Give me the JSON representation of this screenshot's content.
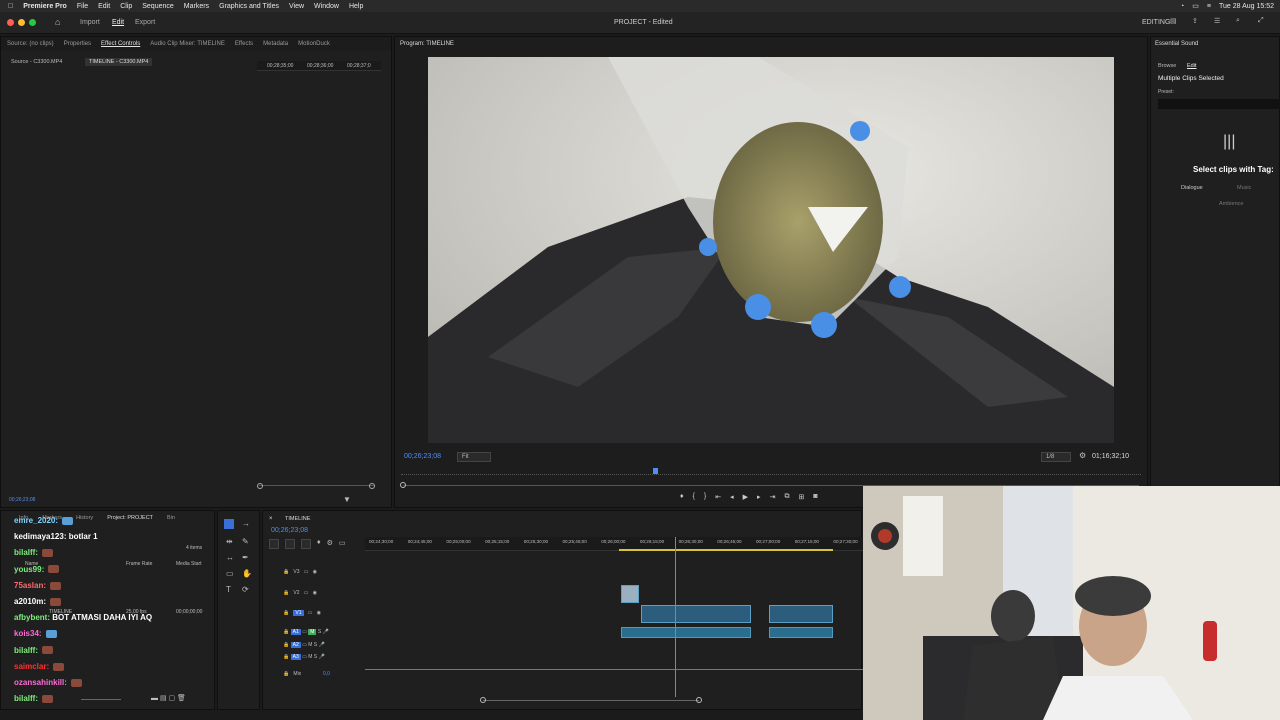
{
  "menubar": {
    "app": "Premiere Pro",
    "items": [
      "File",
      "Edit",
      "Clip",
      "Sequence",
      "Markers",
      "Graphics and Titles",
      "View",
      "Window",
      "Help"
    ],
    "datetime": "Tue 28 Aug 15:52"
  },
  "titlebar": {
    "home_tabs": [
      "Import",
      "Edit",
      "Export"
    ],
    "active_home_tab": "Edit",
    "title": "PROJECT - Edited",
    "workspace": "EDITING"
  },
  "source_panel": {
    "tabs": [
      "Source: (no clips)",
      "Properties",
      "Effect Controls",
      "Audio Clip Mixer: TIMELINE",
      "Effects",
      "Metadata",
      "MotionDuck"
    ],
    "active_tab": "Effect Controls",
    "subtabs": [
      "Source - C3300.MP4",
      "TIMELINE - C3300.MP4"
    ],
    "ruler_times": [
      "00;28;35;00",
      "00;28;36;00",
      "00;28;37;0"
    ],
    "timecode": "00;26;23;08"
  },
  "program_monitor": {
    "title": "Program: TIMELINE",
    "timecode": "00;26;23;08",
    "fit": "Fit",
    "resolution": "1/8",
    "duration": "01;16;32;10"
  },
  "essential_sound": {
    "title": "Essential Sound",
    "tabs": [
      "Browse",
      "Edit"
    ],
    "active_tab": "Edit",
    "subtitle": "Multiple Clips Selected",
    "preset_label": "Preset:",
    "prompt": "Select clips with Tag:",
    "tags": [
      "Dialogue",
      "Music",
      "Ambience"
    ]
  },
  "project_panel": {
    "tabs": [
      "Info",
      "Markers",
      "History",
      "Project: PROJECT",
      "Bin"
    ],
    "active_tab": "Project: PROJECT",
    "item_count": "4 items",
    "columns": [
      "Name",
      "Frame Rate",
      "Media Start"
    ],
    "rows": [
      {
        "name": "TIMELINE",
        "fps": "25,00 fps",
        "start": "00;00;00;00"
      }
    ]
  },
  "timeline": {
    "tab": "TIMELINE",
    "timecode": "00;26;23;08",
    "ruler_times": [
      "00;24;30;00",
      "00;24;45;00",
      "00;25;00;00",
      "00;25;15;00",
      "00;25;30;00",
      "00;25;45;00",
      "00;26;00;00",
      "00;26;15;00",
      "00;26;30;00",
      "00;26;45;00",
      "00;27;00;00",
      "00;27;15;00",
      "00;27;30;00"
    ],
    "video_tracks": [
      "V3",
      "V2",
      "V1"
    ],
    "audio_tracks": [
      "A1",
      "A2",
      "A3"
    ],
    "mix_label": "Mix",
    "mix_value": "0,0"
  },
  "chat": [
    {
      "user": "emre_2020:",
      "color": "#7ed3ff",
      "msg": "",
      "emote": "hand"
    },
    {
      "user": "kedimaya123:",
      "color": "#ffffff",
      "msg": "botlar 1",
      "emote": ""
    },
    {
      "user": "bilalff:",
      "color": "#7bf07b",
      "msg": "",
      "emote": "face"
    },
    {
      "user": "yous99:",
      "color": "#7bf07b",
      "msg": "",
      "emote": "face"
    },
    {
      "user": "75aslan:",
      "color": "#ff6a6a",
      "msg": "",
      "emote": "face"
    },
    {
      "user": "a2010m:",
      "color": "#ffffff",
      "msg": "",
      "emote": "face"
    },
    {
      "user": "afbybent:",
      "color": "#7bf07b",
      "msg": "BOT ATMASI DAHA IYI AQ",
      "emote": ""
    },
    {
      "user": "kois34:",
      "color": "#ff6ad5",
      "msg": "",
      "emote": "hand"
    },
    {
      "user": "bilalff:",
      "color": "#7bf07b",
      "msg": "",
      "emote": "face"
    },
    {
      "user": "saimclar:",
      "color": "#ff3030",
      "msg": "",
      "emote": "face"
    },
    {
      "user": "ozansahinkill:",
      "color": "#ff6ad5",
      "msg": "",
      "emote": "face"
    },
    {
      "user": "bilalff:",
      "color": "#7bf07b",
      "msg": "",
      "emote": "face"
    }
  ],
  "colors": {
    "accent": "#4f8ef7",
    "clip": "#2c5d7d",
    "work_area": "#d6c43a"
  }
}
